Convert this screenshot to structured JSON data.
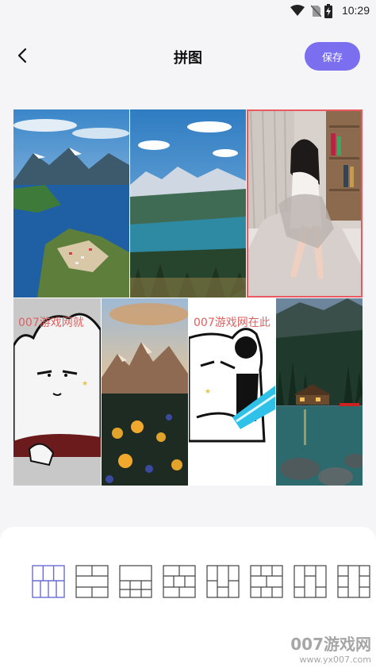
{
  "status_bar": {
    "time": "10:29",
    "icons": [
      "wifi-icon",
      "no-sim-icon",
      "battery-charging-icon"
    ]
  },
  "header": {
    "title": "拼图",
    "back_icon": "chevron-left-icon",
    "save_label": "保存",
    "accent": "#7b6ff0"
  },
  "collage": {
    "selected_cell": 3,
    "selected_color": "#e85a60",
    "cells": [
      {
        "name": "mountain-fjord-photo"
      },
      {
        "name": "mountain-lake-photo"
      },
      {
        "name": "girl-portrait-photo"
      },
      {
        "name": "cat-sketch-image",
        "overlay_text": "007游戏网就"
      },
      {
        "name": "mountain-flowers-photo"
      },
      {
        "name": "panda-meme-image",
        "overlay_text": "007游戏网在此"
      },
      {
        "name": "lake-cabin-photo"
      }
    ]
  },
  "layouts": {
    "selected_index": 0,
    "items": [
      "layout-1",
      "layout-2",
      "layout-3",
      "layout-4",
      "layout-5",
      "layout-6",
      "layout-7",
      "layout-8"
    ]
  },
  "watermark": {
    "title": "007游戏网",
    "url": "www.yx007.com"
  }
}
